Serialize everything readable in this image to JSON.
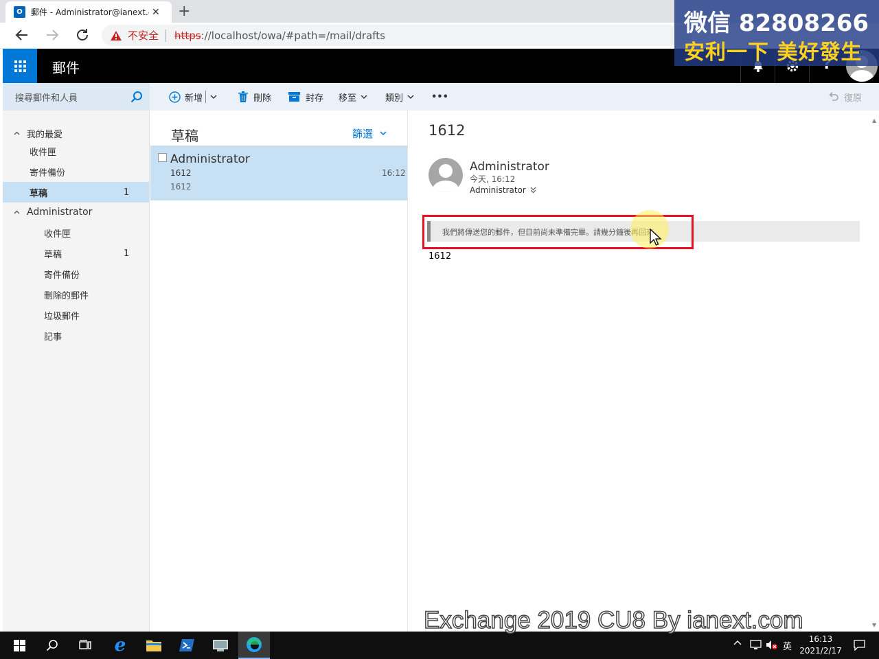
{
  "browser": {
    "tab_title": "郵件 - Administrator@ianext.com",
    "insecure_label": "不安全",
    "url_scheme": "https",
    "url_rest": "://localhost/owa/#path=/mail/drafts"
  },
  "owa": {
    "app_title": "郵件"
  },
  "search": {
    "placeholder": "搜尋郵件和人員"
  },
  "toolbar": {
    "new_label": "新增",
    "delete_label": "刪除",
    "archive_label": "封存",
    "move_label": "移至",
    "categories_label": "類別",
    "more_label": "•••",
    "undo_label": "復原"
  },
  "folders": {
    "favorites_header": "我的最愛",
    "favorites": [
      {
        "label": "收件匣",
        "count": ""
      },
      {
        "label": "寄件備份",
        "count": ""
      },
      {
        "label": "草稿",
        "count": "1"
      }
    ],
    "account_header": "Administrator",
    "account_folders": [
      {
        "label": "收件匣",
        "count": ""
      },
      {
        "label": "草稿",
        "count": "1"
      },
      {
        "label": "寄件備份",
        "count": ""
      },
      {
        "label": "刪除的郵件",
        "count": ""
      },
      {
        "label": "垃圾郵件",
        "count": ""
      },
      {
        "label": "記事",
        "count": ""
      }
    ]
  },
  "message_list": {
    "title": "草稿",
    "filter_label": "篩選",
    "items": [
      {
        "sender": "Administrator",
        "subject": "1612",
        "time": "16:12",
        "preview": "1612"
      }
    ]
  },
  "reading": {
    "subject": "1612",
    "sender": "Administrator",
    "date": "今天, 16:12",
    "to": "Administrator",
    "notice": "我們將傳送您的郵件，但目前尚未準備完畢。請幾分鐘後再回來。",
    "body": "1612"
  },
  "taskbar": {
    "time": "16:13",
    "date": "2021/2/17",
    "ime": "英"
  },
  "watermark": {
    "line1": "微信 82808266",
    "line2": "安利一下 美好發生",
    "bottom": "Exchange 2019 CU8 By ianext.com"
  },
  "colors": {
    "owa_blue": "#0078d7",
    "selected_item": "#c7e0f4",
    "highlight_red": "#e81123"
  }
}
